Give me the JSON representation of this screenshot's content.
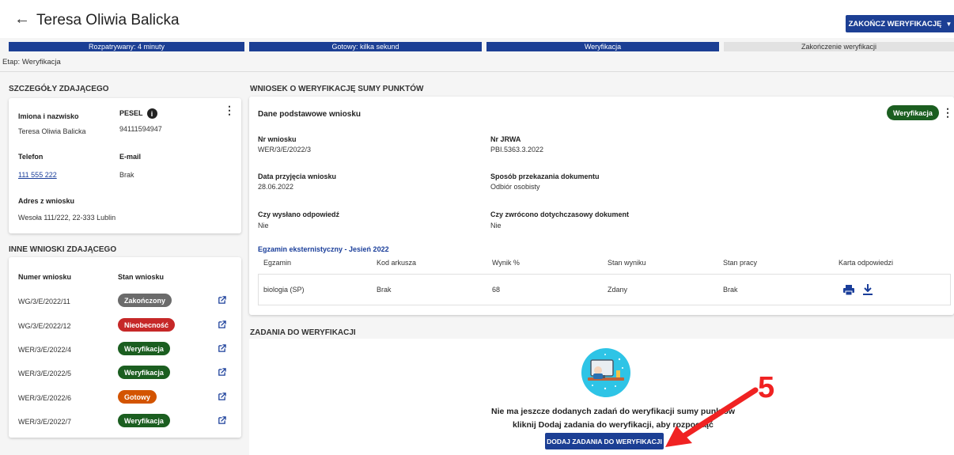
{
  "header": {
    "title": "Teresa Oliwia Balicka",
    "finish_button": "ZAKOŃCZ WERYFIKACJĘ",
    "stage_line": "Etap: Weryfikacja"
  },
  "steps": [
    {
      "label": "Rozpatrywany: 4 minuty"
    },
    {
      "label": "Gotowy: kilka sekund"
    },
    {
      "label": "Weryfikacja"
    },
    {
      "label": "Zakończenie weryfikacji"
    }
  ],
  "details": {
    "section_title": "SZCZEGÓŁY ZDAJĄCEGO",
    "name_label": "Imiona i nazwisko",
    "name_value": "Teresa Oliwia Balicka",
    "pesel_label": "PESEL",
    "pesel_value": "94111594947",
    "phone_label": "Telefon",
    "phone_value": "111 555 222",
    "email_label": "E-mail",
    "email_value": "Brak",
    "address_label": "Adres z wniosku",
    "address_value": "Wesoła 111/222, 22-333 Lublin"
  },
  "other_apps": {
    "section_title": "INNE WNIOSKI ZDAJĄCEGO",
    "col_number": "Numer wniosku",
    "col_status": "Stan wniosku",
    "rows": [
      {
        "number": "WG/3/E/2022/11",
        "status": "Zakończony",
        "color": "#6b6b6b"
      },
      {
        "number": "WG/3/E/2022/12",
        "status": "Nieobecność",
        "color": "#c62828"
      },
      {
        "number": "WER/3/E/2022/4",
        "status": "Weryfikacja",
        "color": "#1b5e20"
      },
      {
        "number": "WER/3/E/2022/5",
        "status": "Weryfikacja",
        "color": "#1b5e20"
      },
      {
        "number": "WER/3/E/2022/6",
        "status": "Gotowy",
        "color": "#d35400"
      },
      {
        "number": "WER/3/E/2022/7",
        "status": "Weryfikacja",
        "color": "#1b5e20"
      }
    ]
  },
  "application": {
    "section_title": "WNIOSEK O WERYFIKACJĘ SUMY PUNKTÓW",
    "card_title": "Dane podstawowe wniosku",
    "status_badge": "Weryfikacja",
    "fields": [
      {
        "label": "Nr wniosku",
        "value": "WER/3/E/2022/3"
      },
      {
        "label": "Nr JRWA",
        "value": "PBI.5363.3.2022"
      },
      {
        "label": "Data przyjęcia wniosku",
        "value": "28.06.2022"
      },
      {
        "label": "Sposób przekazania dokumentu",
        "value": "Odbiór osobisty"
      },
      {
        "label": "Czy wysłano odpowiedź",
        "value": "Nie"
      },
      {
        "label": "Czy zwrócono dotychczasowy dokument",
        "value": "Nie"
      }
    ],
    "exam_title": "Egzamin eksternistyczny - Jesień 2022",
    "table_headers": [
      "Egzamin",
      "Kod arkusza",
      "Wynik %",
      "Stan wyniku",
      "Stan pracy",
      "Karta odpowiedzi"
    ],
    "table_row": [
      "biologia (SP)",
      "Brak",
      "68",
      "Zdany",
      "Brak"
    ]
  },
  "tasks": {
    "section_title": "ZADANIA DO WERYFIKACJI",
    "empty_line1": "Nie ma jeszcze dodanych zadań do weryfikacji sumy punktów",
    "empty_line2": "kliknij Dodaj zadania do weryfikacji, aby rozpocząć",
    "add_button": "DODAJ ZADANIA DO WERYFIKACJI"
  },
  "annotation": {
    "number": "5"
  },
  "icons": [
    "back-arrow-icon",
    "caret-down-icon",
    "info-icon",
    "kebab-menu-icon",
    "external-link-icon",
    "print-icon",
    "download-icon",
    "empty-state-illustration",
    "red-arrow-annotation"
  ]
}
